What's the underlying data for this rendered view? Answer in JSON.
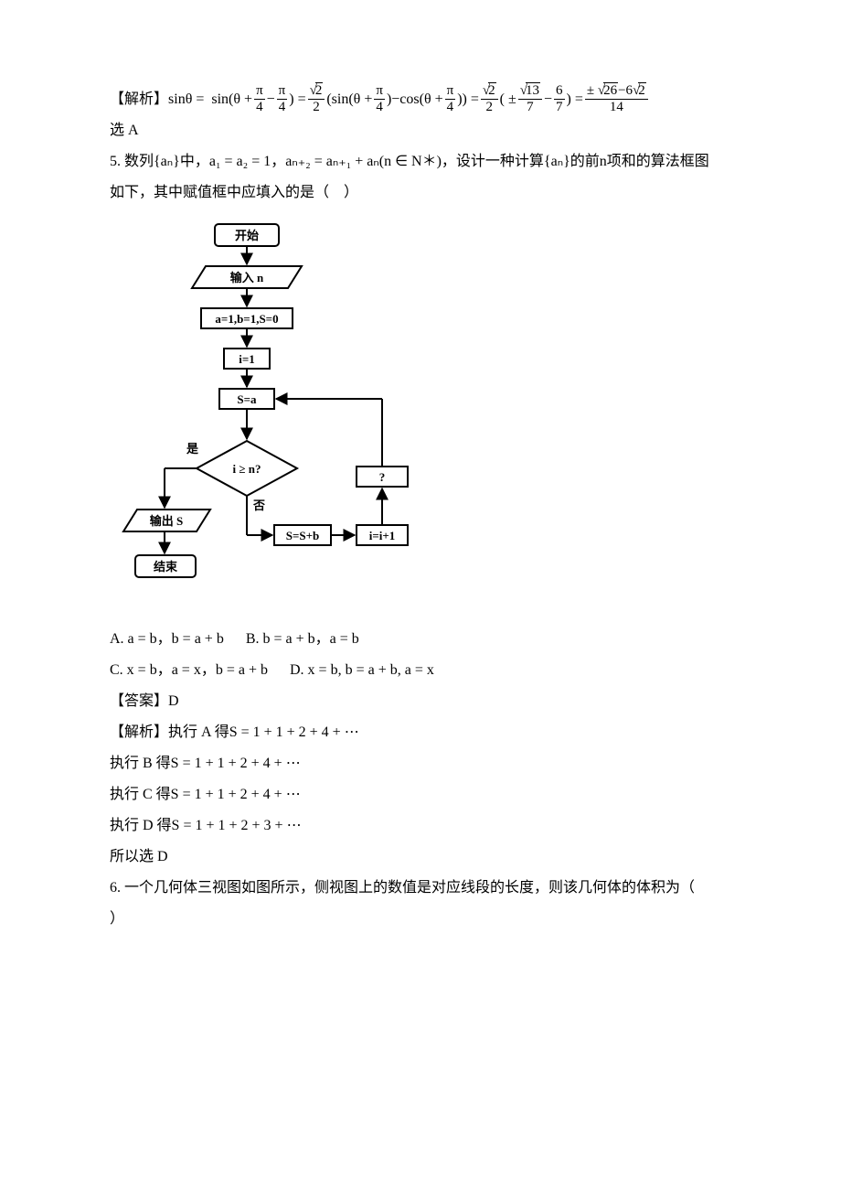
{
  "q4_explain": {
    "label": "【解析】",
    "prefix": "sinθ =  sin(θ + ",
    "frac1_num": "π",
    "frac1_den": "4",
    "dash1": "−",
    "frac2_num": "π",
    "frac2_den": "4",
    "paren1_close": ") = ",
    "frac3_num_rad": "2",
    "frac3_den": "2",
    "mid1": "(sin(θ + ",
    "frac4_num": "π",
    "frac4_den": "4",
    "mid2": ")−cos(θ + ",
    "frac5_num": "π",
    "frac5_den": "4",
    "mid3": ")) = ",
    "frac6_num_rad": "2",
    "frac6_den": "2",
    "mid4": "( ± ",
    "frac7_num_rad": "13",
    "frac7_den": "7",
    "mid5": "−",
    "frac8_num": "6",
    "frac8_den": "7",
    "mid6": ") = ",
    "frac9_num_pm": "± ",
    "frac9_num_rad1": "26",
    "frac9_num_dash": "−6",
    "frac9_num_rad2": "2",
    "frac9_den": "14",
    "conclusion": "选 A"
  },
  "q5": {
    "number": "5.",
    "stem1": "数列{aₙ}中，a₁ = a₂ = 1，aₙ₊₂ = aₙ₊₁ + aₙ(n ∈ N＊)，设计一种计算{aₙ}的前n项和的算法框图",
    "stem2": "如下，其中赋值框中应填入的是（　）",
    "optA": "A.  a = b，b = a + b",
    "optB": "B.  b = a + b，a = b",
    "optC": "C.  x = b，a = x，b = a + b",
    "optD": "D.  x = b, b = a + b, a = x",
    "answer_label": "【答案】",
    "answer_val": "D",
    "explain_label": "【解析】",
    "explain_A": "执行 A 得S = 1 + 1 + 2 + 4 + ⋯",
    "explain_B": "执行 B 得S = 1 + 1 + 2 + 4 + ⋯",
    "explain_C": "执行 C 得S = 1 + 1 + 2 + 4 + ⋯",
    "explain_D": "执行 D 得S = 1 + 1 + 2 + 3 + ⋯",
    "explain_conclusion": "所以选 D"
  },
  "flowchart": {
    "start": "开始",
    "input": "输入 n",
    "init": "a=1,b=1,S=0",
    "ieq1": "i=1",
    "se": "S=a",
    "cond": "i ≥ n?",
    "yes": "是",
    "no": "否",
    "output": "输出 S",
    "end": "结束",
    "ssb": "S=S+b",
    "iinc": "i=i+1",
    "blank": "?"
  },
  "q6": {
    "number": "6.",
    "stem1": "一个几何体三视图如图所示，侧视图上的数值是对应线段的长度，则该几何体的体积为（",
    "stem2": "）"
  },
  "chart_data": {
    "type": "table",
    "description": "Algorithm flowchart structure for computing partial sums of Fibonacci-like sequence",
    "nodes": [
      {
        "id": "start",
        "type": "terminator",
        "label": "开始"
      },
      {
        "id": "input",
        "type": "io",
        "label": "输入 n"
      },
      {
        "id": "init",
        "type": "process",
        "label": "a=1,b=1,S=0"
      },
      {
        "id": "i1",
        "type": "process",
        "label": "i=1"
      },
      {
        "id": "sa",
        "type": "process",
        "label": "S=a"
      },
      {
        "id": "cond",
        "type": "decision",
        "label": "i ≥ n?"
      },
      {
        "id": "out",
        "type": "io",
        "label": "输出 S"
      },
      {
        "id": "end",
        "type": "terminator",
        "label": "结束"
      },
      {
        "id": "ssb",
        "type": "process",
        "label": "S=S+b"
      },
      {
        "id": "iinc",
        "type": "process",
        "label": "i=i+1"
      },
      {
        "id": "blank",
        "type": "process",
        "label": "?"
      }
    ],
    "edges": [
      [
        "start",
        "input"
      ],
      [
        "input",
        "init"
      ],
      [
        "init",
        "i1"
      ],
      [
        "i1",
        "sa"
      ],
      [
        "sa",
        "cond"
      ],
      [
        "cond",
        "out",
        "是"
      ],
      [
        "out",
        "end"
      ],
      [
        "cond",
        "ssb",
        "否"
      ],
      [
        "ssb",
        "iinc"
      ],
      [
        "iinc",
        "blank"
      ],
      [
        "blank",
        "sa_loop_back"
      ]
    ]
  }
}
